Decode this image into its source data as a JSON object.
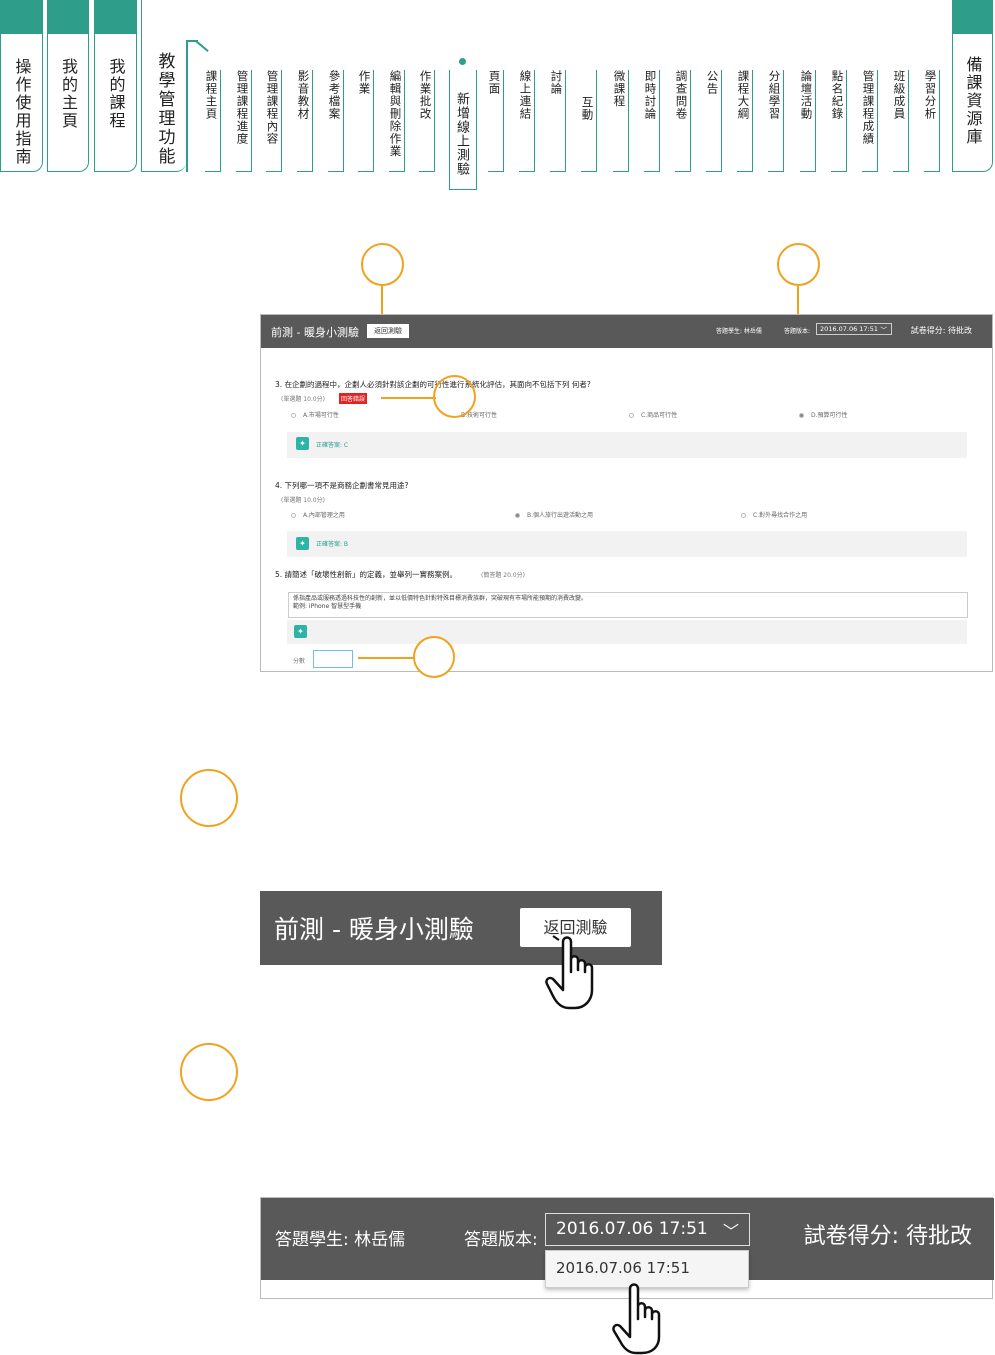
{
  "main_tabs": [
    {
      "label": "操作使用指南"
    },
    {
      "label": "我的主頁"
    },
    {
      "label": "我的課程"
    },
    {
      "label": "教學管理功能"
    },
    {
      "label": "備課資源庫"
    }
  ],
  "sub_tabs": [
    {
      "label": "課程主頁"
    },
    {
      "label": "管理課程進度"
    },
    {
      "label": "管理課程內容"
    },
    {
      "label": "影音教材"
    },
    {
      "label": "參考檔案"
    },
    {
      "label": "作業"
    },
    {
      "label": "編輯與刪除作業"
    },
    {
      "label": "作業批改"
    },
    {
      "label": "新增線上測驗"
    },
    {
      "label": "頁面"
    },
    {
      "label": "線上連結"
    },
    {
      "label": "討論"
    },
    {
      "label": "互動"
    },
    {
      "label": "微課程"
    },
    {
      "label": "即時討論"
    },
    {
      "label": "調查問卷"
    },
    {
      "label": "公告"
    },
    {
      "label": "課程大綱"
    },
    {
      "label": "分組學習"
    },
    {
      "label": "論壇活動"
    },
    {
      "label": "點名紀錄"
    },
    {
      "label": "管理課程成績"
    },
    {
      "label": "班級成員"
    },
    {
      "label": "學習分析"
    }
  ],
  "panel": {
    "title": "前測 - 暖身小測驗",
    "back_button": "返回測驗",
    "student_label": "答題學生: 林岳儒",
    "version_label": "答題版本:",
    "version_value": "2016.07.06 17:51",
    "score": "試卷得分: 待批改",
    "q3": {
      "text": "3.  在企劃的過程中，企劃人必須針對該企劃的可行性進行系統化評估，其面向不包括下列 何者?",
      "meta": "(單選題  10.0分)",
      "wrong_tag": "回答錯誤",
      "options": [
        "A.市場可行性",
        "B.技術可行性",
        "C.商品可行性",
        "D.預算可行性"
      ],
      "answer": "正確答案: C"
    },
    "q4": {
      "text": "4.  下列哪一項不是商務企劃書常見用途?",
      "meta": "(單選題  10.0分)",
      "options": [
        "A.內部管理之用",
        "B.個人旅行出遊活動之用",
        "C.對外尋找合作之用"
      ],
      "answer": "正確答案: B"
    },
    "q5": {
      "text": "5.  請簡述「破壞性創新」的定義，並舉列一實務案例。",
      "meta": "(簡答題  20.0分)",
      "essay_line1": "係指產品或服務透過科技性的創新，並以低價特色針對特殊目標消費族群，突破現有市場所能預期的消費改變。",
      "essay_line2": "範例: iPhone 智慧型手機",
      "score_label": "分數"
    }
  },
  "zoom1": {
    "title": "前測 - 暖身小測驗",
    "button": "返回測驗"
  },
  "zoom2": {
    "student": "答題學生: 林岳儒",
    "version_label": "答題版本:",
    "version_value": "2016.07.06 17:51",
    "score": "試卷得分: 待批改",
    "dropdown_option": "2016.07.06 17:51"
  },
  "colors": {
    "teal": "#2e9e8b",
    "orange": "#f0a21e",
    "header_gray": "#595959",
    "wrong_red": "#e32222"
  }
}
